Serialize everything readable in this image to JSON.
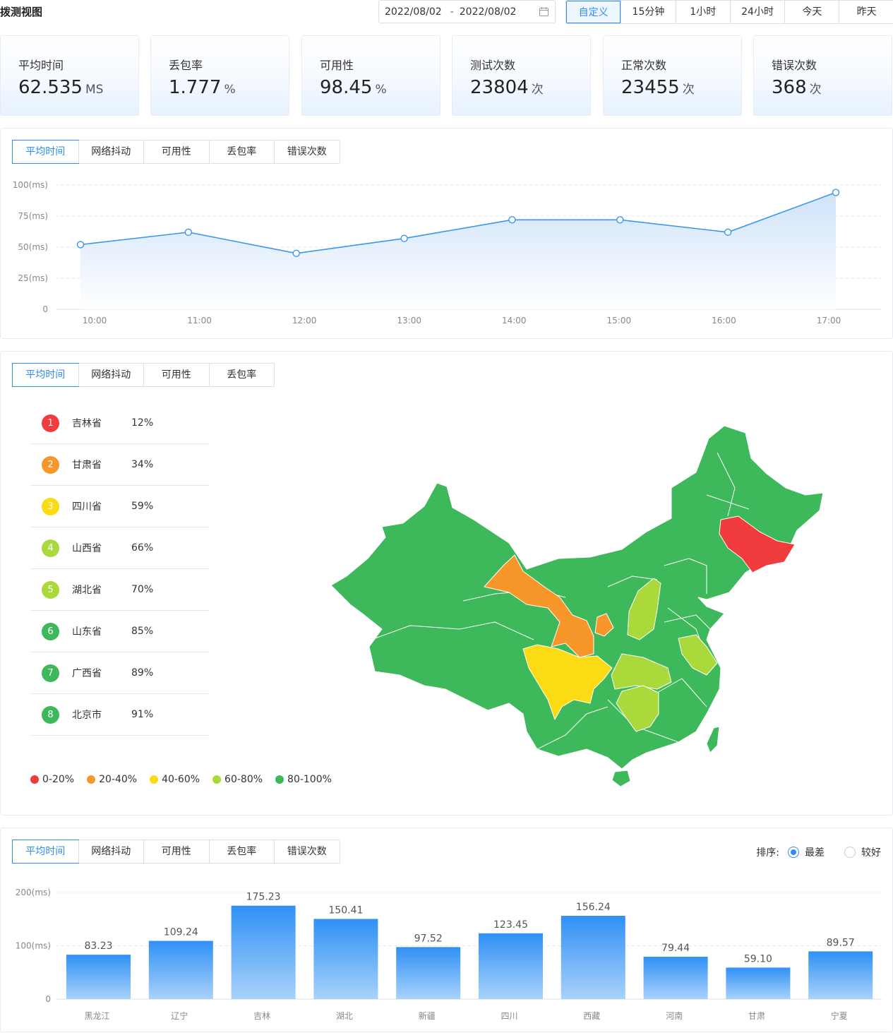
{
  "header": {
    "title": "拨测视图",
    "date_start": "2022/08/02",
    "date_sep": "-",
    "date_end": "2022/08/02",
    "quick_ranges": [
      "自定义",
      "15分钟",
      "1小时",
      "24小时",
      "今天",
      "昨天"
    ],
    "quick_active": 0
  },
  "stats": [
    {
      "label": "平均时间",
      "value": "62.535",
      "unit": "MS"
    },
    {
      "label": "丢包率",
      "value": "1.777",
      "unit": "%"
    },
    {
      "label": "可用性",
      "value": "98.45",
      "unit": "%"
    },
    {
      "label": "测试次数",
      "value": "23804",
      "unit": "次"
    },
    {
      "label": "正常次数",
      "value": "23455",
      "unit": "次"
    },
    {
      "label": "错误次数",
      "value": "368",
      "unit": "次"
    }
  ],
  "line_panel": {
    "tabs": [
      "平均时间",
      "网络抖动",
      "可用性",
      "丢包率",
      "错误次数"
    ]
  },
  "map_panel": {
    "tabs": [
      "平均时间",
      "网络抖动",
      "可用性",
      "丢包率"
    ],
    "ranking": [
      {
        "rank": "1",
        "name": "吉林省",
        "pct": "12%",
        "color": "#f03c3c"
      },
      {
        "rank": "2",
        "name": "甘肃省",
        "pct": "34%",
        "color": "#f7962b"
      },
      {
        "rank": "3",
        "name": "四川省",
        "pct": "59%",
        "color": "#fadb14"
      },
      {
        "rank": "4",
        "name": "山西省",
        "pct": "66%",
        "color": "#a9d93a"
      },
      {
        "rank": "5",
        "name": "湖北省",
        "pct": "70%",
        "color": "#a9d93a"
      },
      {
        "rank": "6",
        "name": "山东省",
        "pct": "85%",
        "color": "#3db85a"
      },
      {
        "rank": "7",
        "name": "广西省",
        "pct": "89%",
        "color": "#3db85a"
      },
      {
        "rank": "8",
        "name": "北京市",
        "pct": "91%",
        "color": "#3db85a"
      }
    ],
    "legend": [
      {
        "label": "0-20%",
        "color": "#f03c3c"
      },
      {
        "label": "20-40%",
        "color": "#f7962b"
      },
      {
        "label": "40-60%",
        "color": "#fadb14"
      },
      {
        "label": "60-80%",
        "color": "#a9d93a"
      },
      {
        "label": "80-100%",
        "color": "#3db85a"
      }
    ]
  },
  "bar_panel": {
    "tabs": [
      "平均时间",
      "网络抖动",
      "可用性",
      "丢包率",
      "错误次数"
    ],
    "sort_label": "排序:",
    "sort_options": [
      "最差",
      "较好"
    ],
    "sort_selected": 0
  },
  "chart_data": [
    {
      "type": "area",
      "x": [
        "10:00",
        "11:00",
        "12:00",
        "13:00",
        "14:00",
        "15:00",
        "16:00",
        "17:00"
      ],
      "values": [
        52,
        62,
        45,
        57,
        72,
        72,
        62,
        94
      ],
      "ylim": [
        0,
        100
      ],
      "y_ticks": [
        "0",
        "25(ms)",
        "50(ms)",
        "75(ms)",
        "100(ms)"
      ],
      "grid": true,
      "color": "#3a96ef"
    },
    {
      "type": "bar",
      "categories": [
        "黑龙江",
        "辽宁",
        "吉林",
        "湖北",
        "新疆",
        "四川",
        "西藏",
        "河南",
        "甘肃",
        "宁夏"
      ],
      "values": [
        83.23,
        109.24,
        175.23,
        150.41,
        97.52,
        123.45,
        156.24,
        79.44,
        59.1,
        89.57
      ],
      "data_labels": [
        "83.23",
        "109.24",
        "175.23",
        "150.41",
        "97.52",
        "123.45",
        "156.24",
        "79.44",
        "59.10",
        "89.57"
      ],
      "ylim": [
        0,
        200
      ],
      "y_ticks": [
        "0",
        "100(ms)",
        "200(ms)"
      ],
      "grid": true,
      "color": "#3b98f5"
    }
  ]
}
